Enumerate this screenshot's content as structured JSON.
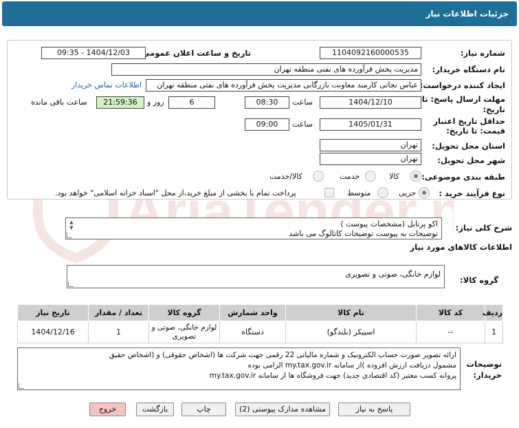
{
  "header": {
    "title": "جزئیات اطلاعات نیاز"
  },
  "form": {
    "need_number": {
      "label": "شماره نیاز:",
      "value": "1104092160000535"
    },
    "announce_dt": {
      "label": "تاریخ و ساعت اعلان عمومی:",
      "value": "1404/12/03 - 09:35"
    },
    "buyer_org": {
      "label": "نام دستگاه خریدار:",
      "value": "مدیریت پخش فرآورده های نفتی منطقه تهران"
    },
    "requester": {
      "label": "ایجاد کننده درخواست:",
      "value": "عباس نجاتی کارمند معاونت بازرگانی مدیریت پخش فرآورده های نفتی منطقه تهران",
      "contact_link": "اطلاعات تماس خریدار"
    },
    "reply_deadline": {
      "label_line1": "مهلت ارسال پاسخ: تا",
      "label_line2": "تاریخ:",
      "date": "1404/12/10",
      "time_label": "ساعت",
      "time": "08:30",
      "days": "6",
      "days_label": "روز و",
      "remaining": "21:59:36",
      "remaining_label": "ساعت باقی مانده"
    },
    "price_validity": {
      "label_line1": "حداقل تاریخ اعتبار",
      "label_line2": "قیمت: تا تاریخ:",
      "date": "1405/01/31",
      "time_label": "ساعت",
      "time": "09:00"
    },
    "province": {
      "label": "استان محل تحویل:",
      "value": "تهران"
    },
    "city": {
      "label": "شهر محل تحویل:",
      "value": "تهران"
    },
    "category": {
      "label": "طبقه بندی موضوعی:",
      "options": [
        "کالا",
        "خدمت",
        "کالا/خدمت"
      ]
    },
    "process": {
      "label": "نوع فرآیند خرید :",
      "options": [
        "جزیی",
        "متوسط"
      ],
      "payment_note": "پرداخت تمام یا بخشی از مبلغ خرید،از محل \"اسناد خزانه اسلامی\" خواهد بود."
    }
  },
  "description": {
    "label": "شرح کلی نیاز:",
    "line1": "اکو پرتابل (مشخصات پیوست )",
    "line2": "توضیحات به پیوست توضیحات کاتالوگ می باشد"
  },
  "goods": {
    "section_title": "اطلاعات کالاهای مورد نیاز",
    "group_label": "گروه کالا:",
    "group_value": "لوازم خانگی، صوتی و تصویری",
    "table": {
      "headers": [
        "ردیف",
        "کد کالا",
        "نام کالا",
        "واحد شمارش",
        "گروه کالا",
        "تعداد / مقدار",
        "تاریخ نیاز"
      ],
      "rows": [
        [
          "1",
          "--",
          "اسپیکر (بلندگو)",
          "دستگاه",
          "لوازم خانگی، صوتی و تصویری",
          "1",
          "1404/12/16"
        ]
      ]
    }
  },
  "buyer_notes": {
    "label_line1": "توضیحات",
    "label_line2": "خریدار:",
    "line1": "ارائه  تصویر صورت حساب الکترونیک و شماره مالیاتی 22 رقمی  جهت شرکت ها (اشخاص حقوقی) و (اشخاص حقیق",
    "line2": "مشمول دریافت ارزش افزوده )از سامانه my.tax.gov.ir  الزامی بوده",
    "line3": "پروانه کسب معتبر (کد اقتصادی جدید) جهت فروشگاه ها از سامانه my.tax.gov.ir"
  },
  "buttons": {
    "reply": "پاسخ به نیاز",
    "attachments": "مشاهده مدارک پیوستی (2)",
    "print": "چاپ",
    "back": "بازگشت",
    "exit": "خروج"
  },
  "watermark": {
    "text": "AriaTender.net"
  },
  "colors": {
    "header": "#1e6e98",
    "remaining_bg": "#d6f0c6",
    "exit_bg": "#f6c3c3",
    "link": "#1a5fb4"
  }
}
